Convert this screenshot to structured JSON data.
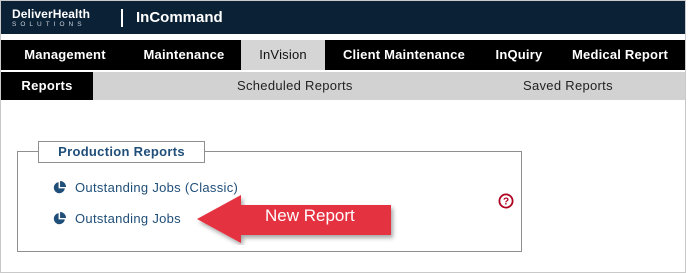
{
  "header": {
    "logo_main": "DeliverHealth",
    "logo_sub": "SOLUTIONS",
    "app_title": "InCommand"
  },
  "menu": {
    "items": [
      {
        "label": "Management"
      },
      {
        "label": "Maintenance"
      },
      {
        "label": "InVision",
        "active": true
      },
      {
        "label": "Client Maintenance"
      },
      {
        "label": "InQuiry"
      },
      {
        "label": "Medical Report"
      }
    ]
  },
  "subtabs": {
    "items": [
      {
        "label": "Reports",
        "active": true
      },
      {
        "label": "Scheduled Reports"
      },
      {
        "label": "Saved Reports"
      }
    ]
  },
  "panel": {
    "legend": "Production Reports",
    "reports": [
      {
        "label": "Outstanding Jobs (Classic)",
        "icon": "pie-chart-icon"
      },
      {
        "label": "Outstanding Jobs",
        "icon": "pie-chart-icon"
      }
    ],
    "help_icon": "question-circle-icon"
  },
  "annotation": {
    "label": "New Report",
    "color": "#e5303f"
  },
  "colors": {
    "header_bg": "#0b2136",
    "menu_bg": "#000000",
    "menu_active_bg": "#d5d5d5",
    "subbar_bg": "#d2d2d2",
    "link": "#1f4e79",
    "help": "#b00020"
  }
}
